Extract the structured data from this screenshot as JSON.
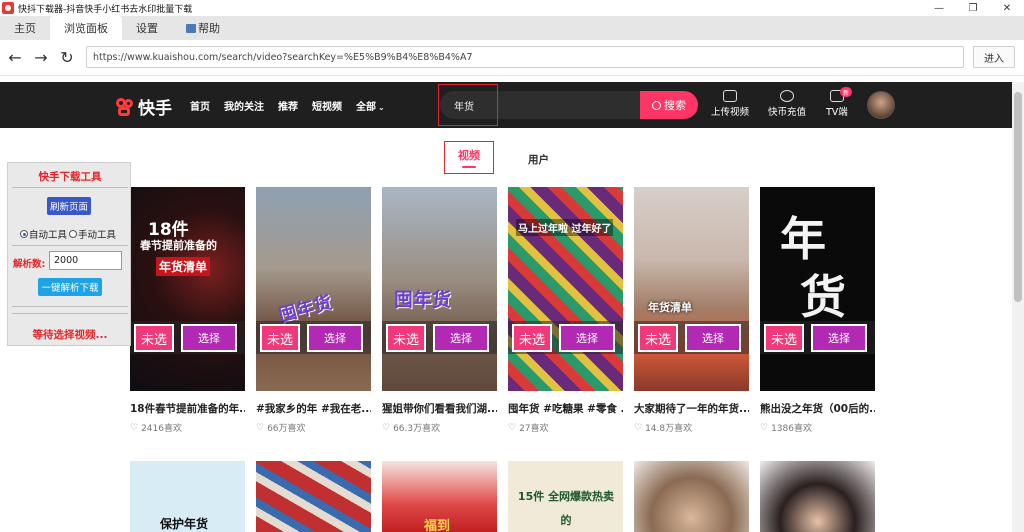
{
  "window": {
    "title": "快抖下载器-抖音快手小红书去水印批量下载",
    "minimize": "—",
    "maximize": "❐",
    "close": "✕"
  },
  "tabs": [
    {
      "label": "主页"
    },
    {
      "label": "浏览面板"
    },
    {
      "label": "设置"
    },
    {
      "label": "帮助"
    }
  ],
  "address": {
    "url": "https://www.kuaishou.com/search/video?searchKey=%E5%B9%B4%E8%B4%A7",
    "go_label": "进入"
  },
  "ks_header": {
    "logo_text": "快手",
    "nav": [
      "首页",
      "我的关注",
      "推荐",
      "短视频",
      "全部"
    ],
    "search_value": "年货",
    "search_button": "搜索",
    "right": [
      {
        "label": "上传视频",
        "icon": "upload-icon"
      },
      {
        "label": "快币充值",
        "icon": "coin-icon"
      },
      {
        "label": "TV端",
        "icon": "tv-icon"
      }
    ],
    "tv_badge": "新"
  },
  "content_tabs": {
    "video": "视频",
    "user": "用户"
  },
  "tool_panel": {
    "title": "快手下载工具",
    "refresh_label": "刷新页面",
    "radio_auto": "自动工具",
    "radio_manual": "手动工具",
    "count_label": "解析数:",
    "count_value": "2000",
    "parse_label": "一键解析下载",
    "status": "等待选择视频..."
  },
  "card_buttons": {
    "unselected": "未选",
    "select": "选择"
  },
  "videos": [
    {
      "title": "18件春节提前准备的年...",
      "likes": "2416喜欢",
      "overlay": "18件 春节提前准备的 年货清单"
    },
    {
      "title": "#我家乡的年 #我在老...",
      "likes": "66万喜欢",
      "overlay": "囤年货"
    },
    {
      "title": "猩姐带你们看看我们湖...",
      "likes": "66.3万喜欢",
      "overlay": "囤年货"
    },
    {
      "title": "囤年货 #吃糖果 #零食 ...",
      "likes": "27喜欢",
      "overlay": "马上过年啦 过年好了"
    },
    {
      "title": "大家期待了一年的年货...",
      "likes": "14.8万喜欢",
      "overlay": "年货清单"
    },
    {
      "title": "熊出没之年货（00后的...",
      "likes": "1386喜欢",
      "overlay": "年货"
    }
  ],
  "videos_row2": [
    {
      "overlay": "保护年货"
    },
    {
      "overlay": ""
    },
    {
      "overlay": "福到"
    },
    {
      "overlay": "15件 全网爆款热卖的"
    },
    {
      "overlay": ""
    },
    {
      "overlay": ""
    }
  ]
}
